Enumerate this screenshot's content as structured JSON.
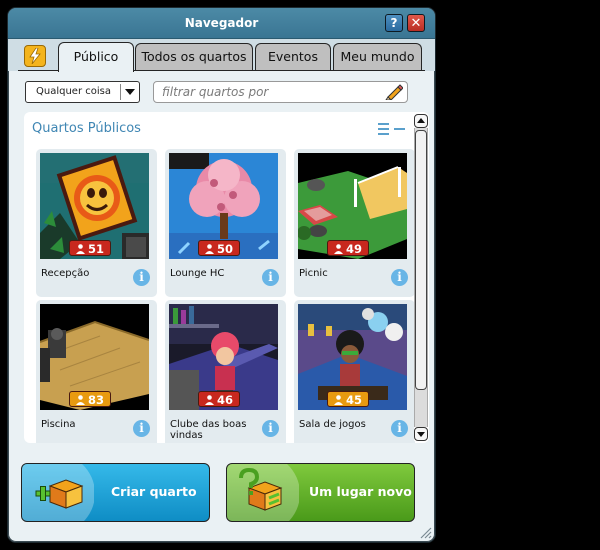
{
  "window": {
    "title": "Navegador",
    "help_label": "?",
    "close_label": "✕"
  },
  "tabs": [
    {
      "label": "Público",
      "active": true
    },
    {
      "label": "Todos os quartos",
      "active": false
    },
    {
      "label": "Eventos",
      "active": false
    },
    {
      "label": "Meu mundo",
      "active": false
    }
  ],
  "filter": {
    "selected": "Qualquer coisa",
    "search_placeholder": "filtrar quartos por"
  },
  "section": {
    "title": "Quartos Públicos"
  },
  "rooms": [
    {
      "name": "Recepção",
      "users": "51",
      "badge_color": "#c8281e"
    },
    {
      "name": "Lounge HC",
      "users": "50",
      "badge_color": "#c8281e"
    },
    {
      "name": "Picnic",
      "users": "49",
      "badge_color": "#c8281e"
    },
    {
      "name": "Piscina",
      "users": "83",
      "badge_color": "#e89a10"
    },
    {
      "name": "Clube das boas vindas",
      "users": "46",
      "badge_color": "#c8281e"
    },
    {
      "name": "Sala de jogos",
      "users": "45",
      "badge_color": "#e89a10"
    }
  ],
  "buttons": {
    "create_room": "Criar quarto",
    "random_room": "Um lugar novo"
  },
  "colors": {
    "title_bar": "#3f7f9c",
    "accent_blue": "#3f86b3",
    "create": "#1ea3da",
    "random": "#62b22c"
  }
}
